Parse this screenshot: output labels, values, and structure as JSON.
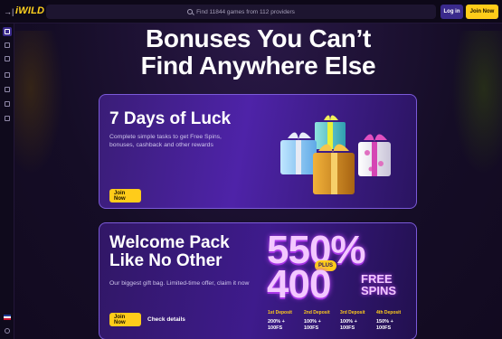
{
  "header": {
    "logo_text": "iWILD",
    "collapse_glyph": "→|",
    "search_placeholder": "Find 11844 games from 112 providers",
    "login_label": "Log in",
    "join_label": "Join Now"
  },
  "sidebar": {
    "items": [
      "home-icon",
      "cards-icon",
      "slots-icon",
      "grid-icon",
      "live-icon",
      "star-icon",
      "gift-icon"
    ],
    "bottom": [
      "flag-uk-icon",
      "chat-icon"
    ]
  },
  "hero": {
    "headline_line1": "Bonuses You Can’t",
    "headline_line2": "Find Anywhere Else"
  },
  "cards": [
    {
      "title": "7 Days of Luck",
      "description": "Complete simple tasks to get Free Spins, bonuses, cashback and other rewards",
      "cta": "Join Now"
    },
    {
      "title": "Welcome Pack Like No Other",
      "description": "Our biggest gift bag. Limited-time offer, claim it now",
      "cta": "Join Now",
      "secondary": "Check details",
      "percent": "550%",
      "plus": "PLUS",
      "free_spins_count": "400",
      "free_spins_label_1": "FREE",
      "free_spins_label_2": "SPINS",
      "deposits": [
        {
          "label": "1st Deposit",
          "value": "200% + 100FS"
        },
        {
          "label": "2nd Deposit",
          "value": "100% + 100FS"
        },
        {
          "label": "3rd Deposit",
          "value": "100% + 100FS"
        },
        {
          "label": "4th Deposit",
          "value": "150% + 100FS"
        }
      ]
    }
  ],
  "colors": {
    "accent": "#ffcc1a",
    "primary": "#3a2a8c",
    "background": "#140c24"
  }
}
